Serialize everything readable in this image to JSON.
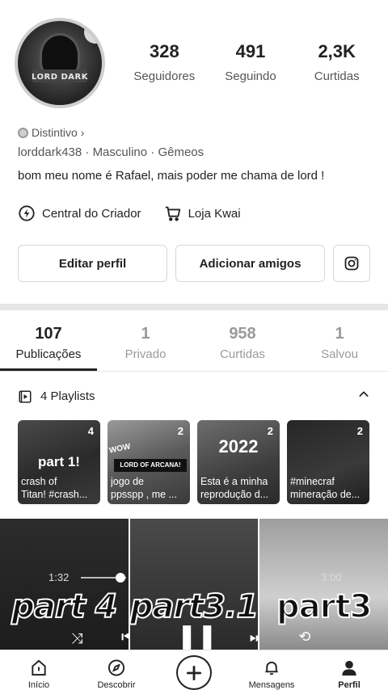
{
  "profile": {
    "avatar_text": "LORD DARK",
    "stats": [
      {
        "value": "328",
        "label": "Seguidores"
      },
      {
        "value": "491",
        "label": "Seguindo"
      },
      {
        "value": "2,3K",
        "label": "Curtidas"
      }
    ],
    "badge_label": "Distintivo",
    "username": "lorddark438",
    "gender": "Masculino",
    "sign": "Gêmeos",
    "bio": "bom meu nome é Rafael, mais poder me chama de lord !",
    "link_creator": "Central do Criador",
    "link_shop": "Loja Kwai",
    "edit_button": "Editar perfil",
    "add_friends_button": "Adicionar amigos"
  },
  "tabs": [
    {
      "count": "107",
      "label": "Publicações",
      "active": true
    },
    {
      "count": "1",
      "label": "Privado"
    },
    {
      "count": "958",
      "label": "Curtidas"
    },
    {
      "count": "1",
      "label": "Salvou"
    }
  ],
  "playlists": {
    "title": "4 Playlists",
    "items": [
      {
        "count": "4",
        "overlay": "part 1!",
        "caption_1": "crash of",
        "caption_2": "Titan! #crash..."
      },
      {
        "count": "2",
        "overlay": "LORD OF ARCANA!",
        "wow": "WOW",
        "caption_1": "jogo de",
        "caption_2": "ppsspp , me ..."
      },
      {
        "count": "2",
        "overlay": "2022",
        "caption_1": "Esta é a minha",
        "caption_2": "reprodução d..."
      },
      {
        "count": "2",
        "overlay": "",
        "caption_1": "#minecraf",
        "caption_2": "mineração de..."
      }
    ]
  },
  "videos": [
    {
      "title": "part 4",
      "time": "1:32"
    },
    {
      "title": "part3.1"
    },
    {
      "title": "part3",
      "time": "3:00"
    }
  ],
  "bottom_nav": [
    {
      "label": "Início",
      "icon": "home-icon"
    },
    {
      "label": "Descobrir",
      "icon": "compass-icon"
    },
    {
      "label": "",
      "icon": "plus-icon"
    },
    {
      "label": "Mensagens",
      "icon": "bell-icon"
    },
    {
      "label": "Perfil",
      "icon": "person-icon",
      "active": true
    }
  ]
}
